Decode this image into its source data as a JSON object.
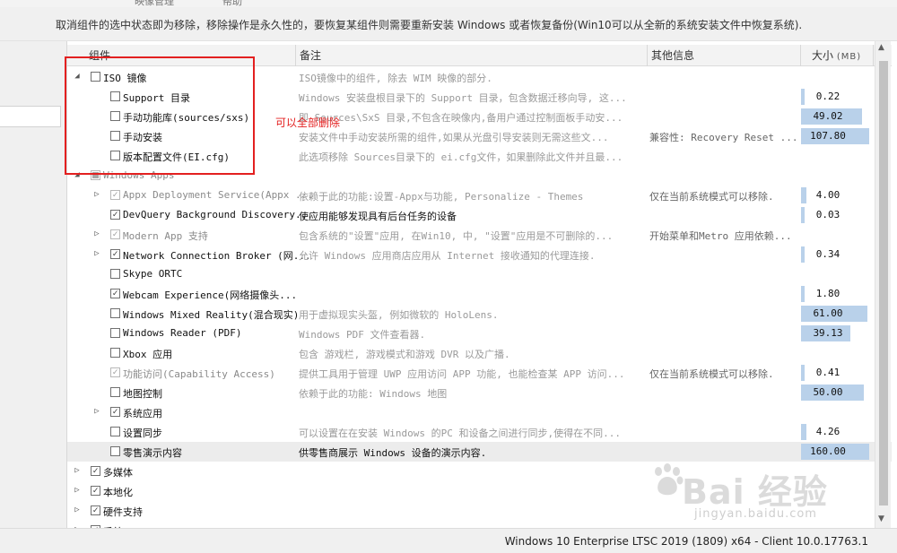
{
  "window": {
    "tabs": [
      "映像管理",
      "帮助"
    ],
    "description": "取消组件的选中状态即为移除，移除操作是永久性的，要恢复某组件则需要重新安装 Windows 或者恢复备份(Win10可以从全新的系统安装文件中恢复系统)."
  },
  "columns": {
    "component": "组件",
    "note": "备注",
    "info": "其他信息",
    "size": "大小",
    "size_unit": "(MB)"
  },
  "rows": [
    {
      "level": 0,
      "expander": "expanded",
      "check": "unchecked",
      "name": "ISO 镜像",
      "note": "ISO镜像中的组件, 除去 WIM 映像的部分.",
      "info": "",
      "size": ""
    },
    {
      "level": 1,
      "expander": "",
      "check": "unchecked",
      "name": "Support 目录",
      "note": "Windows 安装盘根目录下的 Support 目录，包含数据迁移向导, 这...",
      "info": "",
      "size": "0.22",
      "bar": 0.02
    },
    {
      "level": 1,
      "expander": "",
      "check": "unchecked",
      "name": "手动功能库(sources/sxs)",
      "note": "即 Sources\\SxS 目录,不包含在映像内,备用户通过控制面板手动安...",
      "info": "",
      "size": "49.02",
      "bar": 0.9
    },
    {
      "level": 1,
      "expander": "",
      "check": "unchecked",
      "name": "手动安装",
      "note": "安装文件中手动安装所需的组件,如果从光盘引导安装则无需这些文...",
      "info": "兼容性:  Recovery Reset ...",
      "size": "107.80",
      "bar": 1.0
    },
    {
      "level": 1,
      "expander": "",
      "check": "unchecked",
      "name": "版本配置文件(EI.cfg)",
      "note": "此选项移除 Sources目录下的 ei.cfg文件，如果删除此文件并且最...",
      "info": "",
      "size": ""
    },
    {
      "level": 0,
      "expander": "expanded",
      "check": "partial",
      "name": "Windows Apps",
      "note": "",
      "info": "",
      "size": "",
      "disabled": true
    },
    {
      "level": 1,
      "expander": "collapsed",
      "check": "checked",
      "name": "Appx Deployment Service(Appx ...",
      "note": "依赖于此的功能:设置-Appx与功能, Personalize - Themes",
      "info": "仅在当前系统模式可以移除.",
      "size": "4.00",
      "bar": 0.08,
      "disabled": true
    },
    {
      "level": 1,
      "expander": "",
      "check": "checked",
      "name": "DevQuery Background Discovery...",
      "note": "使应用能够发现具有后台任务的设备",
      "info": "",
      "size": "0.03",
      "bar": 0.0,
      "dark_note": true
    },
    {
      "level": 1,
      "expander": "collapsed",
      "check": "checked",
      "name": "Modern App 支持",
      "note": "包含系统的\"设置\"应用, 在Win10, 中, \"设置\"应用是不可删除的...",
      "info": "开始菜单和Metro 应用依赖...",
      "size": "",
      "disabled": true
    },
    {
      "level": 1,
      "expander": "collapsed",
      "check": "checked",
      "name": "Network Connection Broker (网...",
      "note": "允许 Windows 应用商店应用从 Internet 接收通知的代理连接.",
      "info": "",
      "size": "0.34",
      "bar": 0.02
    },
    {
      "level": 1,
      "expander": "",
      "check": "unchecked",
      "name": "Skype ORTC",
      "note": "",
      "info": "",
      "size": ""
    },
    {
      "level": 1,
      "expander": "",
      "check": "checked",
      "name": "Webcam Experience(网络摄像头...",
      "note": "",
      "info": "",
      "size": "1.80",
      "bar": 0.04
    },
    {
      "level": 1,
      "expander": "",
      "check": "unchecked",
      "name": "Windows Mixed Reality(混合现实)",
      "note": "用于虚拟现实头盔, 例如微软的 HoloLens.",
      "info": "",
      "size": "61.00",
      "bar": 0.98
    },
    {
      "level": 1,
      "expander": "",
      "check": "unchecked",
      "name": "Windows Reader (PDF)",
      "note": "Windows PDF 文件查看器.",
      "info": "",
      "size": "39.13",
      "bar": 0.73
    },
    {
      "level": 1,
      "expander": "",
      "check": "unchecked",
      "name": "Xbox 应用",
      "note": "包含 游戏栏, 游戏模式和游戏 DVR 以及广播.",
      "info": "",
      "size": ""
    },
    {
      "level": 1,
      "expander": "",
      "check": "checked",
      "name": "功能访问(Capability Access)",
      "note": "提供工具用于管理 UWP 应用访问 APP 功能, 也能检查某 APP 访问...",
      "info": "仅在当前系统模式可以移除.",
      "size": "0.41",
      "bar": 0.02,
      "disabled": true
    },
    {
      "level": 1,
      "expander": "",
      "check": "unchecked",
      "name": "地图控制",
      "note": "依赖于此的功能: Windows 地图",
      "info": "",
      "size": "50.00",
      "bar": 0.92
    },
    {
      "level": 1,
      "expander": "collapsed",
      "check": "checked",
      "name": "系统应用",
      "note": "",
      "info": "",
      "size": ""
    },
    {
      "level": 1,
      "expander": "",
      "check": "unchecked",
      "name": "设置同步",
      "note": "可以设置在在安装 Windows 的PC 和设备之间进行同步,使得在不同...",
      "info": "",
      "size": "4.26",
      "bar": 0.08
    },
    {
      "level": 1,
      "expander": "",
      "check": "unchecked",
      "name": "零售演示内容",
      "note": "供零售商展示 Windows 设备的演示内容.",
      "info": "",
      "size": "160.00",
      "bar": 1.0,
      "selected": true,
      "dark_note": true
    },
    {
      "level": 0,
      "expander": "collapsed",
      "check": "checked",
      "name": "多媒体",
      "note": "",
      "info": "",
      "size": ""
    },
    {
      "level": 0,
      "expander": "collapsed",
      "check": "checked",
      "name": "本地化",
      "note": "",
      "info": "",
      "size": ""
    },
    {
      "level": 0,
      "expander": "collapsed",
      "check": "checked",
      "name": "硬件支持",
      "note": "",
      "info": "",
      "size": ""
    },
    {
      "level": 0,
      "expander": "collapsed",
      "check": "checked",
      "name": "系统",
      "note": "",
      "info": "",
      "size": ""
    }
  ],
  "annotation": "可以全部删除",
  "status": {
    "version": "Windows 10 Enterprise LTSC 2019 (1809) x64 - Client 10.0.17763.1"
  },
  "watermark": {
    "logo": "Bai 经验",
    "url": "jingyan.baidu.com"
  },
  "colors": {
    "size_bar": "#b9d1ea",
    "annotation": "#e32020",
    "selection": "#ececec"
  }
}
